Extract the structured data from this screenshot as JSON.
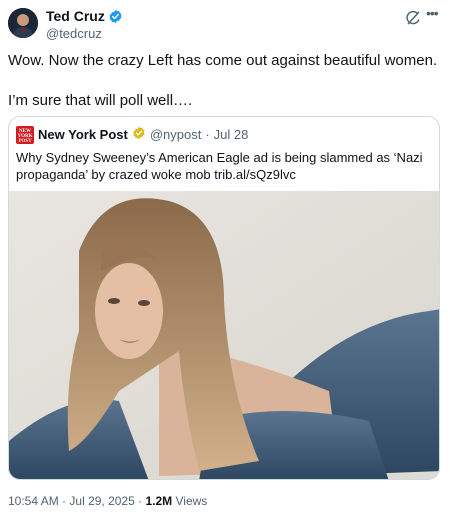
{
  "tweet": {
    "author_name": "Ted Cruz",
    "handle": "@tedcruz",
    "line1": "Wow. Now the crazy Left has come out against beautiful women.",
    "line2": "I’m sure that will poll well….",
    "icons": [
      "grok-icon",
      "more-icon",
      "verified-badge-icon"
    ],
    "accent_color": "#1d9bf0"
  },
  "quote": {
    "logo_text": "NEW YORK POST",
    "author_name": "New York Post",
    "handle": "@nypost",
    "date": "Jul 28",
    "text": "Why Sydney Sweeney’s American Eagle ad is being slammed as ‘Nazi propaganda’ by crazed woke mob trib.al/sQz9lvc",
    "logo_color": "#d31b20",
    "badge_color": "#e2b719"
  },
  "footer": {
    "time": "10:54 AM",
    "date": "Jul 29, 2025",
    "views_count": "1.2M",
    "views_label": "Views"
  }
}
